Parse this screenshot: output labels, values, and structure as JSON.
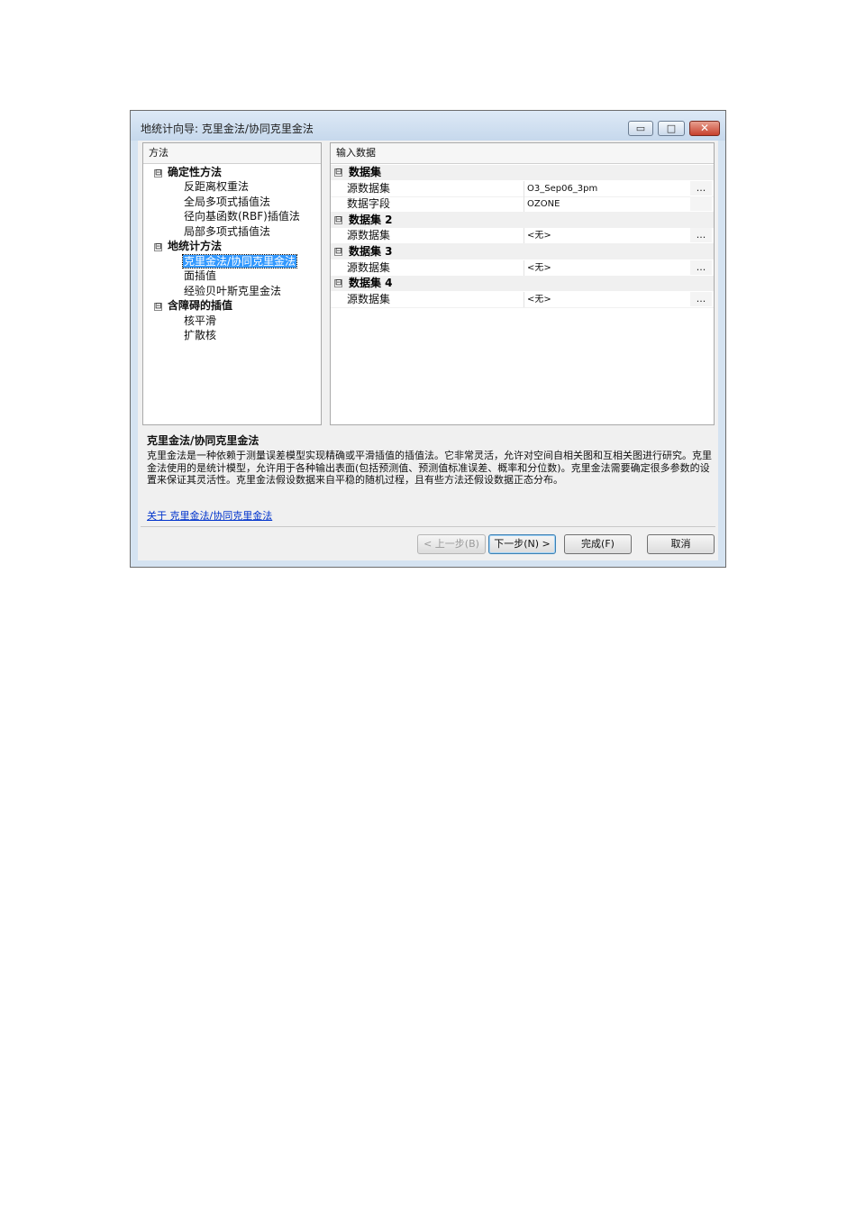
{
  "window": {
    "title": "地统计向导: 克里金法/协同克里金法",
    "controls": {
      "minimize": "▭",
      "maximize": "□",
      "close": "✕"
    }
  },
  "left_pane": {
    "header": "方法",
    "categories": [
      {
        "label": "确定性方法",
        "expander": "⊟",
        "items": [
          "反距离权重法",
          "全局多项式插值法",
          "径向基函数(RBF)插值法",
          "局部多项式插值法"
        ]
      },
      {
        "label": "地统计方法",
        "expander": "⊟",
        "items": [
          "克里金法/协同克里金法",
          "面插值",
          "经验贝叶斯克里金法"
        ]
      },
      {
        "label": "含障碍的插值",
        "expander": "⊟",
        "items": [
          "核平滑",
          "扩散核"
        ]
      }
    ],
    "selected": "克里金法/协同克里金法"
  },
  "right_pane": {
    "header": "输入数据",
    "groups": [
      {
        "label": "数据集",
        "expander": "⊟",
        "props": [
          {
            "name": "源数据集",
            "value": "O3_Sep06_3pm",
            "dots": "..."
          },
          {
            "name": "数据字段",
            "value": "OZONE",
            "dots": ""
          }
        ]
      },
      {
        "label": "数据集 2",
        "expander": "⊟",
        "props": [
          {
            "name": "源数据集",
            "value": "<无>",
            "dots": "..."
          }
        ]
      },
      {
        "label": "数据集 3",
        "expander": "⊟",
        "props": [
          {
            "name": "源数据集",
            "value": "<无>",
            "dots": "..."
          }
        ]
      },
      {
        "label": "数据集 4",
        "expander": "⊟",
        "props": [
          {
            "name": "源数据集",
            "value": "<无>",
            "dots": "..."
          }
        ]
      }
    ]
  },
  "description": {
    "title": "克里金法/协同克里金法",
    "text": "克里金法是一种依赖于测量误差模型实现精确或平滑插值的插值法。它非常灵活，允许对空间自相关图和互相关图进行研究。克里金法使用的是统计模型，允许用于各种输出表面(包括预测值、预测值标准误差、概率和分位数)。克里金法需要确定很多参数的设置来保证其灵活性。克里金法假设数据来自平稳的随机过程，且有些方法还假设数据正态分布。",
    "link": "关于 克里金法/协同克里金法"
  },
  "buttons": {
    "back": "< 上一步(B)",
    "next": "下一步(N) >",
    "finish": "完成(F)",
    "cancel": "取消"
  }
}
